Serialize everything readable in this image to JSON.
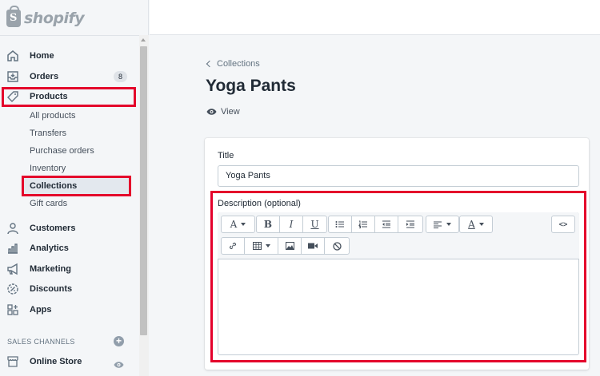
{
  "brand": {
    "name": "shopify"
  },
  "nav": {
    "home": "Home",
    "orders": "Orders",
    "orders_badge": "8",
    "products": "Products",
    "products_sub": [
      "All products",
      "Transfers",
      "Purchase orders",
      "Inventory",
      "Collections",
      "Gift cards"
    ],
    "customers": "Customers",
    "analytics": "Analytics",
    "marketing": "Marketing",
    "discounts": "Discounts",
    "apps": "Apps",
    "sales_channels_title": "SALES CHANNELS",
    "online_store": "Online Store"
  },
  "page": {
    "breadcrumb": "Collections",
    "title": "Yoga Pants",
    "view_label": "View"
  },
  "form": {
    "title_label": "Title",
    "title_value": "Yoga Pants",
    "description_label": "Description (optional)",
    "description_value": ""
  },
  "toolbar": {
    "font_label": "A",
    "bold_label": "B",
    "italic_label": "I",
    "underline_label": "U",
    "color_label": "A",
    "html_label": "<>"
  },
  "colors": {
    "highlight": "#e4002b",
    "sidebar_bg": "#f4f6f8",
    "active_bg": "#e3e8ee"
  }
}
